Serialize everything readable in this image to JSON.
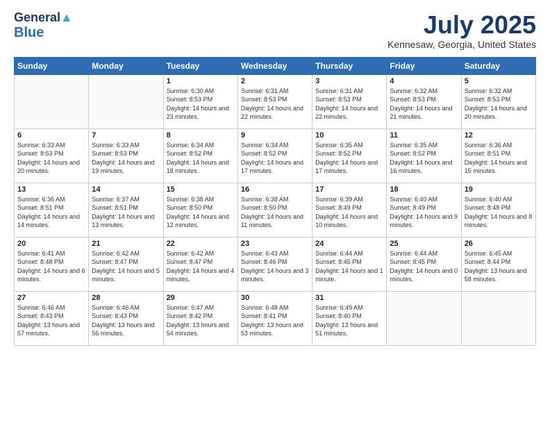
{
  "header": {
    "logo": {
      "line1": "General",
      "line2": "Blue"
    },
    "title": "July 2025",
    "location": "Kennesaw, Georgia, United States"
  },
  "days_of_week": [
    "Sunday",
    "Monday",
    "Tuesday",
    "Wednesday",
    "Thursday",
    "Friday",
    "Saturday"
  ],
  "weeks": [
    [
      {
        "day": "",
        "empty": true
      },
      {
        "day": "",
        "empty": true
      },
      {
        "day": "1",
        "sunrise": "6:30 AM",
        "sunset": "8:53 PM",
        "daylight": "14 hours and 23 minutes."
      },
      {
        "day": "2",
        "sunrise": "6:31 AM",
        "sunset": "8:53 PM",
        "daylight": "14 hours and 22 minutes."
      },
      {
        "day": "3",
        "sunrise": "6:31 AM",
        "sunset": "8:53 PM",
        "daylight": "14 hours and 22 minutes."
      },
      {
        "day": "4",
        "sunrise": "6:32 AM",
        "sunset": "8:53 PM",
        "daylight": "14 hours and 21 minutes."
      },
      {
        "day": "5",
        "sunrise": "6:32 AM",
        "sunset": "8:53 PM",
        "daylight": "14 hours and 20 minutes."
      }
    ],
    [
      {
        "day": "6",
        "sunrise": "6:33 AM",
        "sunset": "8:53 PM",
        "daylight": "14 hours and 20 minutes."
      },
      {
        "day": "7",
        "sunrise": "6:33 AM",
        "sunset": "8:53 PM",
        "daylight": "14 hours and 19 minutes."
      },
      {
        "day": "8",
        "sunrise": "6:34 AM",
        "sunset": "8:52 PM",
        "daylight": "14 hours and 18 minutes."
      },
      {
        "day": "9",
        "sunrise": "6:34 AM",
        "sunset": "8:52 PM",
        "daylight": "14 hours and 17 minutes."
      },
      {
        "day": "10",
        "sunrise": "6:35 AM",
        "sunset": "8:52 PM",
        "daylight": "14 hours and 17 minutes."
      },
      {
        "day": "11",
        "sunrise": "6:35 AM",
        "sunset": "8:52 PM",
        "daylight": "14 hours and 16 minutes."
      },
      {
        "day": "12",
        "sunrise": "6:36 AM",
        "sunset": "8:51 PM",
        "daylight": "14 hours and 15 minutes."
      }
    ],
    [
      {
        "day": "13",
        "sunrise": "6:36 AM",
        "sunset": "8:51 PM",
        "daylight": "14 hours and 14 minutes."
      },
      {
        "day": "14",
        "sunrise": "6:37 AM",
        "sunset": "8:51 PM",
        "daylight": "14 hours and 13 minutes."
      },
      {
        "day": "15",
        "sunrise": "6:38 AM",
        "sunset": "8:50 PM",
        "daylight": "14 hours and 12 minutes."
      },
      {
        "day": "16",
        "sunrise": "6:38 AM",
        "sunset": "8:50 PM",
        "daylight": "14 hours and 11 minutes."
      },
      {
        "day": "17",
        "sunrise": "6:39 AM",
        "sunset": "8:49 PM",
        "daylight": "14 hours and 10 minutes."
      },
      {
        "day": "18",
        "sunrise": "6:40 AM",
        "sunset": "8:49 PM",
        "daylight": "14 hours and 9 minutes."
      },
      {
        "day": "19",
        "sunrise": "6:40 AM",
        "sunset": "8:48 PM",
        "daylight": "14 hours and 8 minutes."
      }
    ],
    [
      {
        "day": "20",
        "sunrise": "6:41 AM",
        "sunset": "8:48 PM",
        "daylight": "14 hours and 6 minutes."
      },
      {
        "day": "21",
        "sunrise": "6:42 AM",
        "sunset": "8:47 PM",
        "daylight": "14 hours and 5 minutes."
      },
      {
        "day": "22",
        "sunrise": "6:42 AM",
        "sunset": "8:47 PM",
        "daylight": "14 hours and 4 minutes."
      },
      {
        "day": "23",
        "sunrise": "6:43 AM",
        "sunset": "8:46 PM",
        "daylight": "14 hours and 3 minutes."
      },
      {
        "day": "24",
        "sunrise": "6:44 AM",
        "sunset": "8:45 PM",
        "daylight": "14 hours and 1 minute."
      },
      {
        "day": "25",
        "sunrise": "6:44 AM",
        "sunset": "8:45 PM",
        "daylight": "14 hours and 0 minutes."
      },
      {
        "day": "26",
        "sunrise": "6:45 AM",
        "sunset": "8:44 PM",
        "daylight": "13 hours and 58 minutes."
      }
    ],
    [
      {
        "day": "27",
        "sunrise": "6:46 AM",
        "sunset": "8:43 PM",
        "daylight": "13 hours and 57 minutes."
      },
      {
        "day": "28",
        "sunrise": "6:46 AM",
        "sunset": "8:43 PM",
        "daylight": "13 hours and 56 minutes."
      },
      {
        "day": "29",
        "sunrise": "6:47 AM",
        "sunset": "8:42 PM",
        "daylight": "13 hours and 54 minutes."
      },
      {
        "day": "30",
        "sunrise": "6:48 AM",
        "sunset": "8:41 PM",
        "daylight": "13 hours and 53 minutes."
      },
      {
        "day": "31",
        "sunrise": "6:49 AM",
        "sunset": "8:40 PM",
        "daylight": "13 hours and 51 minutes."
      },
      {
        "day": "",
        "empty": true
      },
      {
        "day": "",
        "empty": true
      }
    ]
  ],
  "labels": {
    "sunrise": "Sunrise:",
    "sunset": "Sunset:",
    "daylight": "Daylight:"
  }
}
